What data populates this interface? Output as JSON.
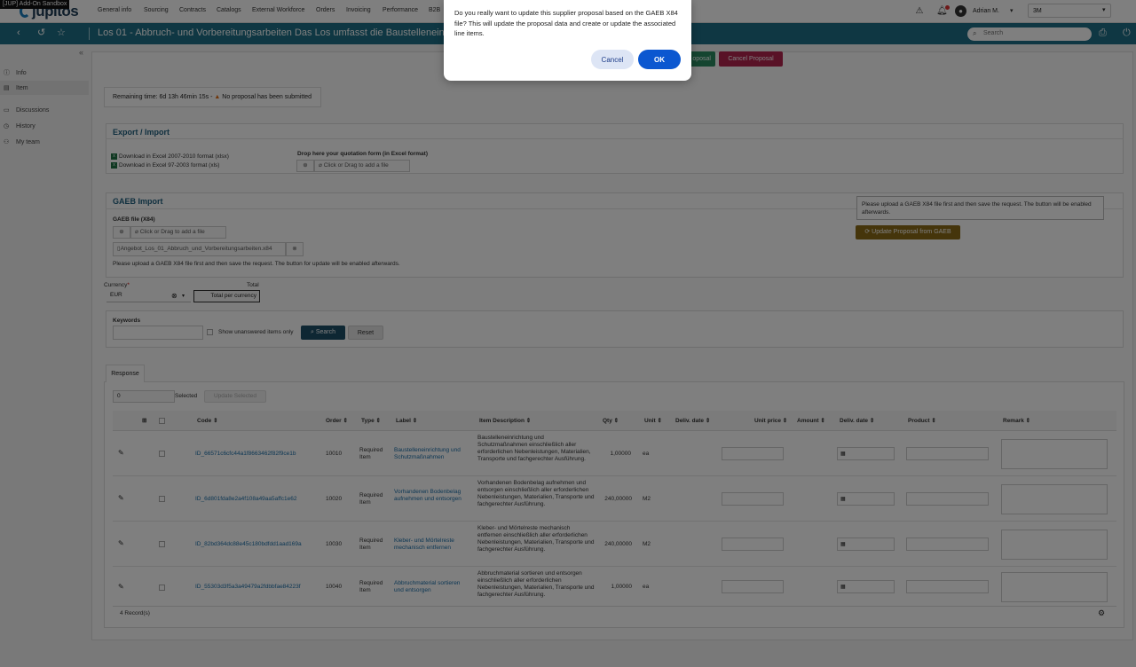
{
  "sandbox_label": "[JUP] Add-On Sandbox",
  "brand": "jupitos",
  "nav": [
    "General info",
    "Sourcing",
    "Contracts",
    "Catalogs",
    "External Workforce",
    "Orders",
    "Invoicing",
    "Performance",
    "B2B"
  ],
  "user": {
    "name": "Adrian M.",
    "tenant": "3M"
  },
  "header": {
    "title": "Los 01 - Abbruch- und Vorbereitungsarbeiten Das Los umfasst die Baustelleneinric...",
    "search_placeholder": "Search"
  },
  "sidebar": [
    {
      "label": "Info",
      "icon": "info-icon"
    },
    {
      "label": "Item",
      "icon": "list-icon"
    },
    {
      "label": "Discussions",
      "icon": "chat-icon"
    },
    {
      "label": "History",
      "icon": "history-icon"
    },
    {
      "label": "My team",
      "icon": "team-icon"
    }
  ],
  "actions": {
    "proposal_partial": "oposal",
    "cancel_proposal": "Cancel Proposal"
  },
  "remaining": {
    "text": "Remaining time: 6d 13h 46min 15s - ",
    "warning": "No proposal has been submitted"
  },
  "export_import": {
    "title": "Export / Import",
    "download_xlsx": "Download in Excel 2007-2010 format (xlsx)",
    "download_xls": "Download in Excel 97-2003 format (xls)",
    "drop_label": "Drop here your quotation form (in Excel format)",
    "upload": "Click or Drag to add a file"
  },
  "gaeb": {
    "title": "GAEB Import",
    "file_label": "GAEB file (X84)",
    "upload": "Click or Drag to add a file",
    "file_name": "Angebot_Los_01_Abbruch_und_Vorbereitungsarbeiten.x84",
    "hint": "Please upload a GAEB X84 file first and then save the request. The button for update will be enabled afterwards.",
    "tooltip": "Please upload a GAEB X84 file first and then save the request. The button will be enabled afterwards.",
    "update_button": "Update Proposal from GAEB"
  },
  "currency": {
    "label": "Currency",
    "required_mark": "*",
    "value": "EUR",
    "total_label": "Total",
    "total_value": "Total per currency"
  },
  "keywords": {
    "label": "Keywords",
    "unanswered": "Show unanswered items only",
    "search": "Search",
    "reset": "Reset"
  },
  "response": {
    "tab": "Response",
    "selected_count": "0",
    "selected_label": "Selected",
    "update_selected": "Update Selected",
    "columns": [
      "Code",
      "Order",
      "Type",
      "Label",
      "Item Description",
      "Qty",
      "Unit",
      "Deliv. date",
      "Unit price",
      "Amount",
      "Deliv. date",
      "Product",
      "Remark"
    ],
    "rows": [
      {
        "code": "ID_66571c6cfc44a1f8663462f82f9ce1b",
        "order": "10010",
        "type": "Required Item",
        "label": "Baustelleneinrichtung und Schutzmaßnahmen",
        "desc": "Baustelleneinrichtung und Schutzmaßnahmen einschließlich aller erforderlichen Nebenleistungen, Materialien, Transporte und fachgerechter Ausführung.",
        "qty": "1,00000",
        "unit": "ea"
      },
      {
        "code": "ID_6d801fda8e2a4f108a49aa5affc1e62",
        "order": "10020",
        "type": "Required Item",
        "label": "Vorhandenen Bodenbelag aufnehmen und entsorgen",
        "desc": "Vorhandenen Bodenbelag aufnehmen und entsorgen einschließlich aller erforderlichen Nebenleistungen, Materialien, Transporte und fachgerechter Ausführung.",
        "qty": "240,00000",
        "unit": "M2"
      },
      {
        "code": "ID_82bd364dc88e45c180bdfdd1aad169a",
        "order": "10030",
        "type": "Required Item",
        "label": "Kleber- und Mörtelreste mechanisch entfernen",
        "desc": "Kleber- und Mörtelreste mechanisch entfernen einschließlich aller erforderlichen Nebenleistungen, Materialien, Transporte und fachgerechter Ausführung.",
        "qty": "240,00000",
        "unit": "M2"
      },
      {
        "code": "ID_55303d3f5a3a49479a2fdbbfae84223f",
        "order": "10040",
        "type": "Required Item",
        "label": "Abbruchmaterial sortieren und entsorgen",
        "desc": "Abbruchmaterial sortieren und entsorgen einschließlich aller erforderlichen Nebenleistungen, Materialien, Transporte und fachgerechter Ausführung.",
        "qty": "1,00000",
        "unit": "ea"
      }
    ],
    "records": "4 Record(s)"
  },
  "dialog": {
    "message": "Do you really want to update this supplier proposal based on the GAEB X84 file? This will update the proposal data and create or update the associated line items.",
    "cancel": "Cancel",
    "ok": "OK"
  }
}
